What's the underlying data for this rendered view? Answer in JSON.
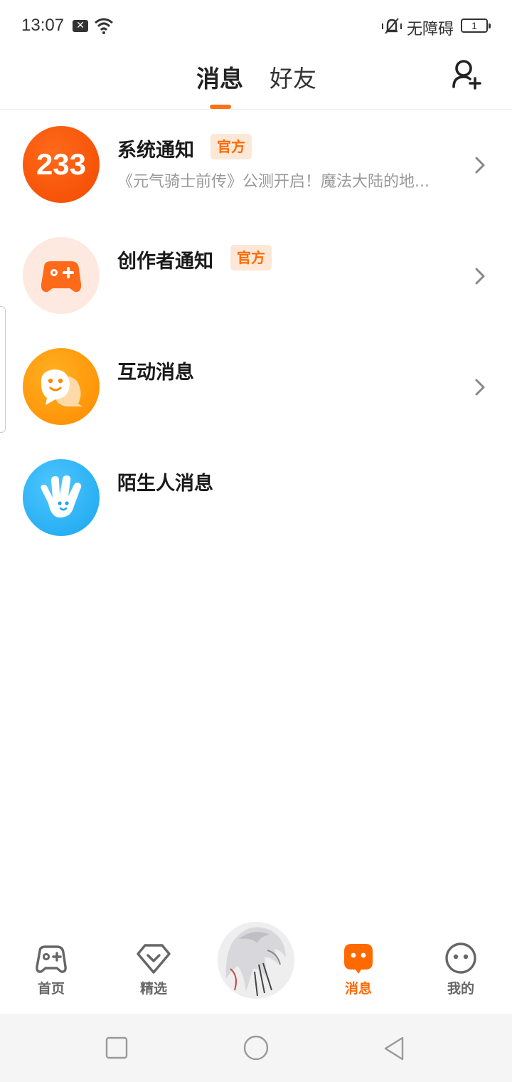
{
  "status_bar": {
    "time": "13:07",
    "notification_icon": "close-box-icon",
    "accessibility_text": "无障碍",
    "battery": "1"
  },
  "header": {
    "tabs": [
      {
        "label": "消息",
        "active": true
      },
      {
        "label": "好友",
        "active": false
      }
    ],
    "add_friend_icon": "add-user-icon",
    "accent_color": "#ff7210"
  },
  "messages": [
    {
      "title": "系统通知",
      "badge": "官方",
      "subtitle": "《元气骑士前传》公测开启！魔法大陆的地...",
      "avatar_text": "233",
      "has_chevron": true
    },
    {
      "title": "创作者通知",
      "badge": "官方",
      "subtitle": "",
      "avatar_icon": "gamepad-icon",
      "has_chevron": true
    },
    {
      "title": "互动消息",
      "subtitle": "",
      "avatar_icon": "chat-bubble-icon",
      "has_chevron": true
    },
    {
      "title": "陌生人消息",
      "subtitle": "",
      "avatar_icon": "waving-hand-icon",
      "has_chevron": false
    }
  ],
  "bottom_nav": {
    "items": [
      {
        "label": "首页",
        "icon": "gamepad-icon",
        "active": false
      },
      {
        "label": "精选",
        "icon": "heart-diamond-icon",
        "active": false
      },
      {
        "label": "消息",
        "icon": "message-icon",
        "active": true
      },
      {
        "label": "我的",
        "icon": "smiley-icon",
        "active": false
      }
    ]
  }
}
